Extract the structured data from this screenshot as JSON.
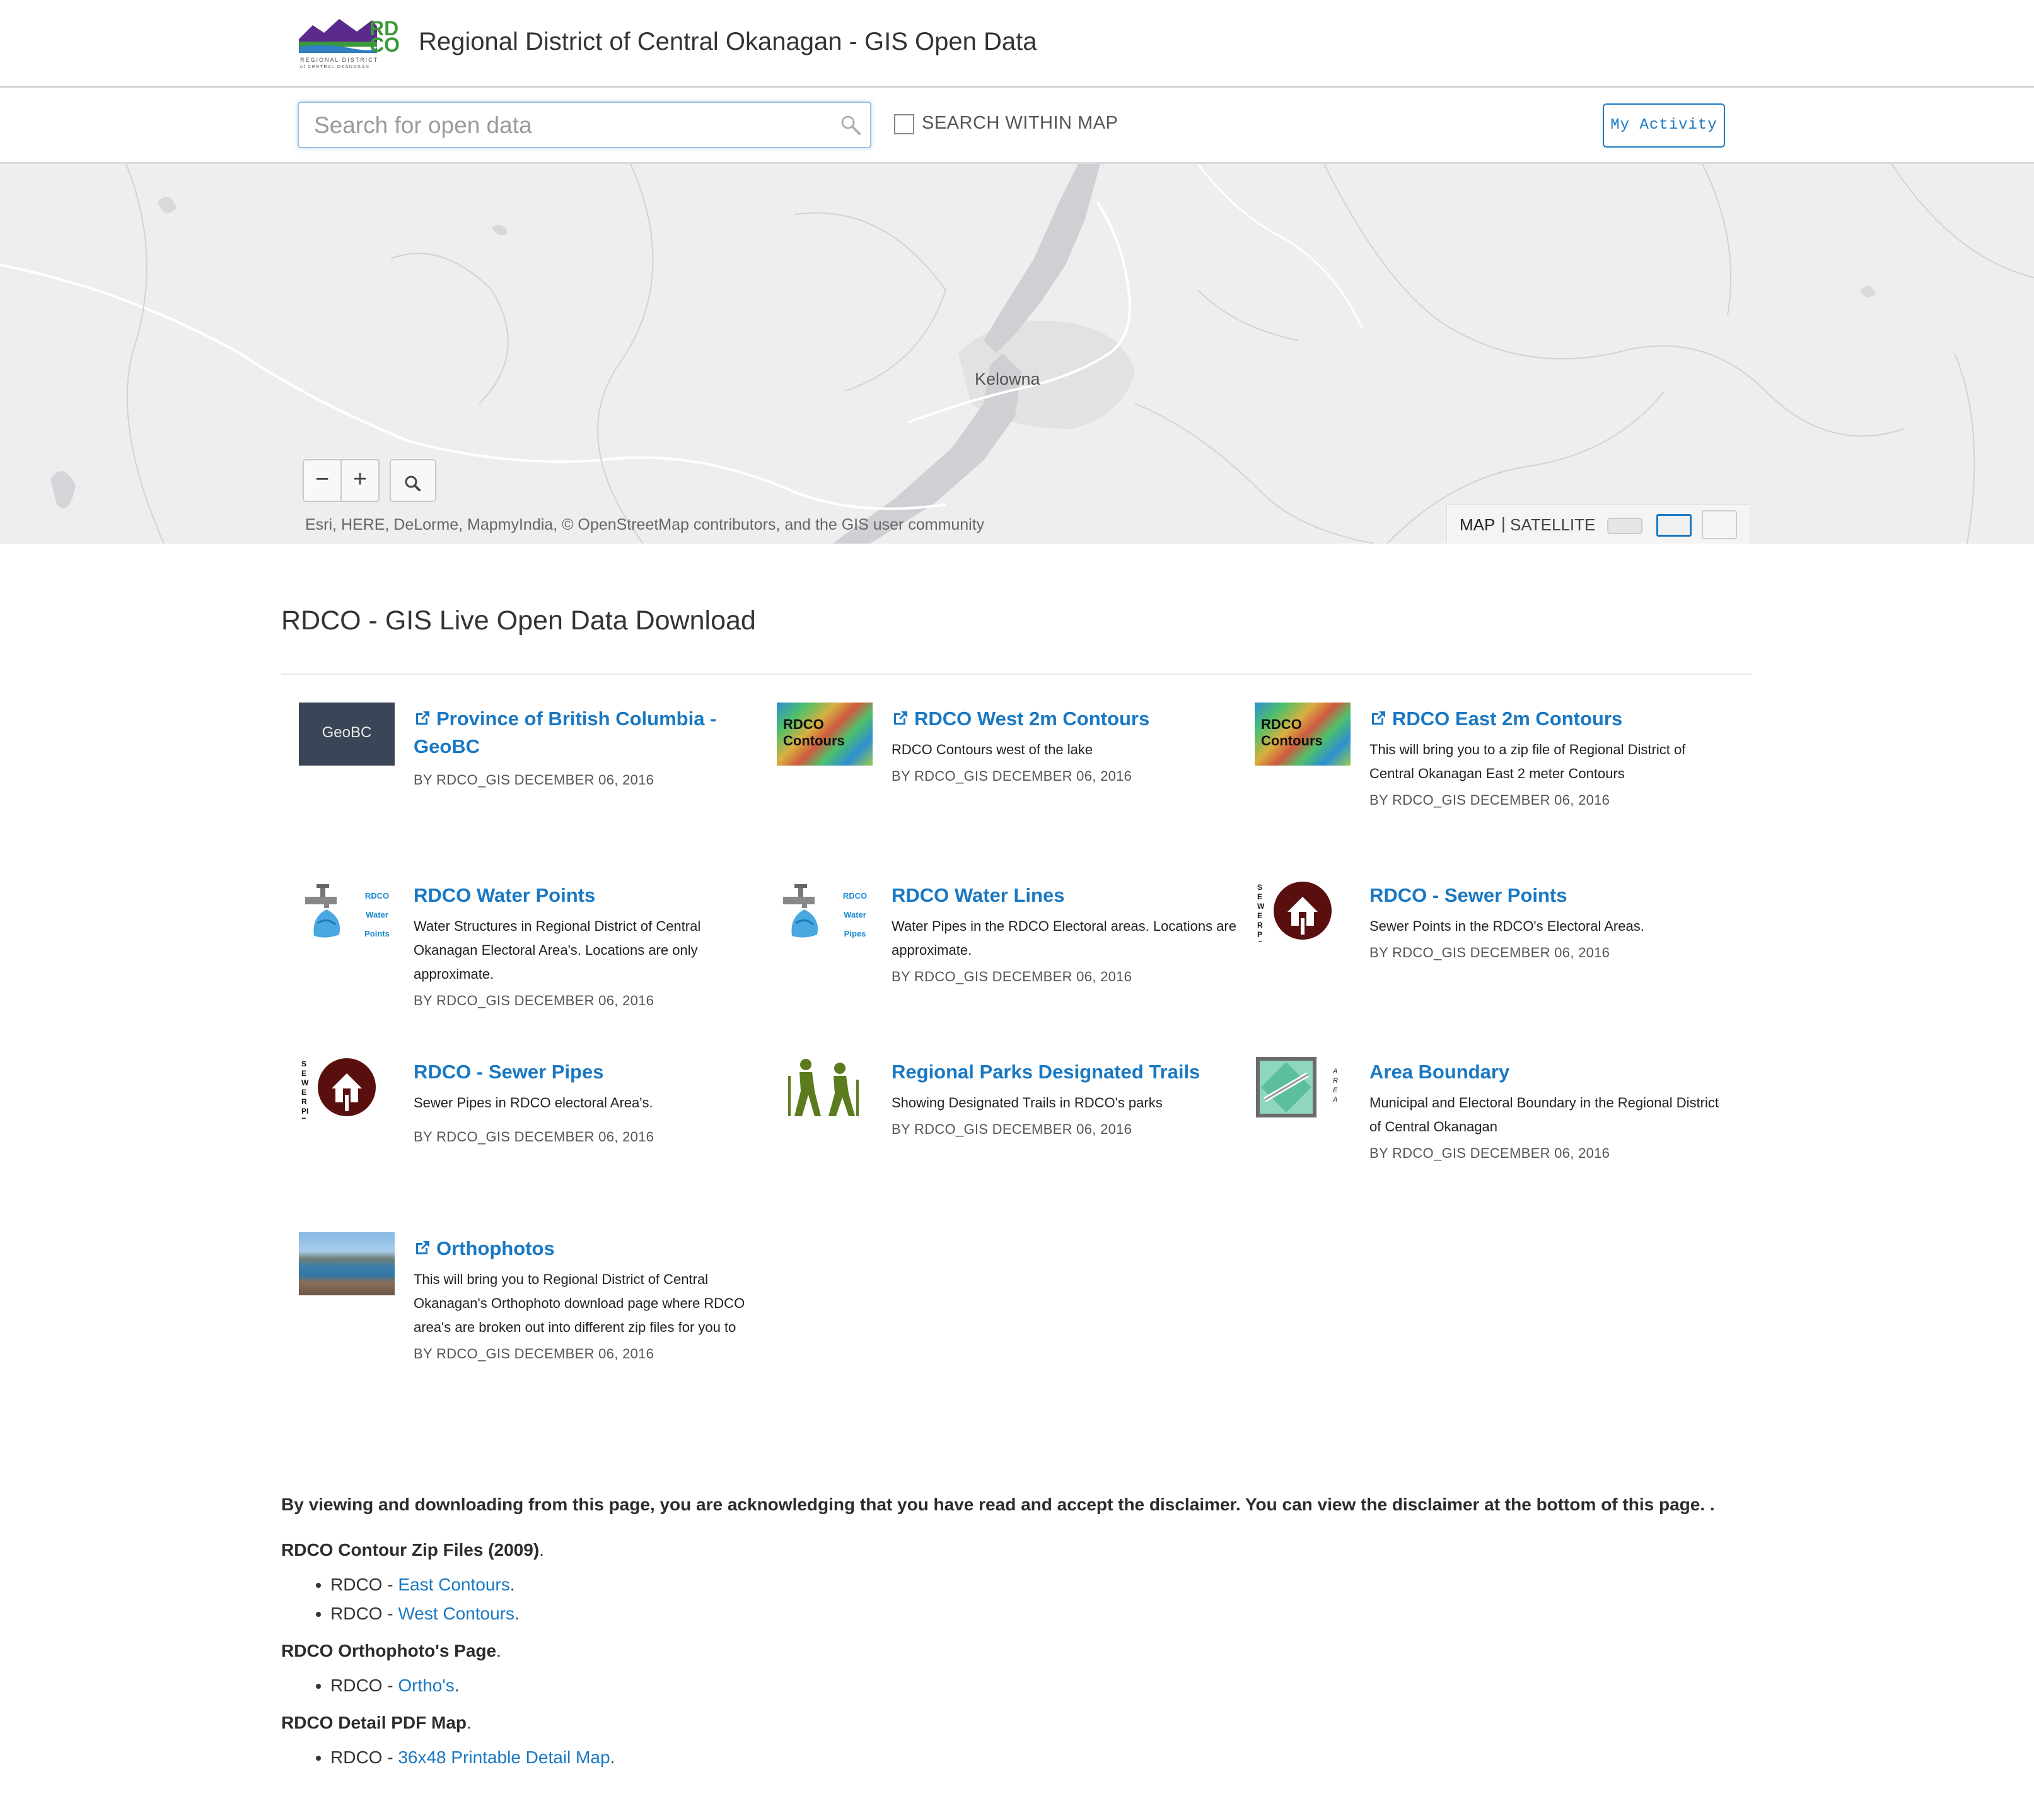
{
  "header": {
    "title": "Regional District of Central Okanagan - GIS Open Data",
    "logo_text": "RDCO",
    "logo_sub": "REGIONAL DISTRICT of CENTRAL OKANAGAN"
  },
  "search": {
    "placeholder": "Search for open data",
    "within_map_label": "SEARCH WITHIN MAP",
    "my_activity_label": "My Activity"
  },
  "map": {
    "city_label": "Kelowna",
    "zoom_out": "−",
    "zoom_in": "+",
    "attribution": "Esri, HERE, DeLorme, MapmyIndia, © OpenStreetMap contributors, and the GIS user community",
    "basemap_map": "MAP",
    "basemap_separator": "|",
    "basemap_satellite": "SATELLITE"
  },
  "section": {
    "title": "RDCO - GIS Live Open Data Download"
  },
  "datasets": [
    {
      "title": "Province of British Columbia - GeoBC",
      "description": "",
      "meta": "BY RDCO_GIS DECEMBER 06, 2016",
      "external": true,
      "thumb": "geobc",
      "thumb_text": "GeoBC"
    },
    {
      "title": "RDCO West 2m Contours",
      "description": "RDCO Contours west of the lake",
      "meta": "BY RDCO_GIS DECEMBER 06, 2016",
      "external": true,
      "thumb": "contours",
      "thumb_text": "RDCO Contours"
    },
    {
      "title": "RDCO East 2m Contours",
      "description": "This will bring you to a zip file of Regional District of Central Okanagan East 2 meter Contours",
      "meta": "BY RDCO_GIS DECEMBER 06, 2016",
      "external": true,
      "thumb": "contours",
      "thumb_text": "RDCO Contours"
    },
    {
      "title": "RDCO Water Points",
      "description": "Water Structures in Regional District of Central Okanagan Electoral Area's.  Locations are only approximate.",
      "meta": "BY RDCO_GIS DECEMBER 06, 2016",
      "external": false,
      "thumb": "water",
      "thumb_text": "RDCO Water Points"
    },
    {
      "title": "RDCO Water Lines",
      "description": "Water Pipes in the RDCO Electoral areas. Locations are approximate.",
      "meta": "BY RDCO_GIS DECEMBER 06, 2016",
      "external": false,
      "thumb": "water",
      "thumb_text": "RDCO Water Pipes"
    },
    {
      "title": "RDCO - Sewer Points",
      "description": "Sewer Points in the RDCO's Electoral Areas.",
      "meta": "BY RDCO_GIS DECEMBER 06, 2016",
      "external": false,
      "thumb": "sewer",
      "thumb_text": "SEWER POINTS"
    },
    {
      "title": "RDCO - Sewer Pipes",
      "description": "Sewer Pipes in RDCO electoral Area's.",
      "meta": "BY RDCO_GIS DECEMBER 06, 2016",
      "external": false,
      "thumb": "sewer",
      "thumb_text": "SEWER PIPES"
    },
    {
      "title": "Regional Parks Designated Trails",
      "description": "Showing Designated Trails in RDCO's parks",
      "meta": "BY RDCO_GIS DECEMBER 06, 2016",
      "external": false,
      "thumb": "trails",
      "thumb_text": ""
    },
    {
      "title": "Area Boundary",
      "description": "Municipal and Electoral Boundary in the Regional District of Central Okanagan",
      "meta": "BY RDCO_GIS DECEMBER 06, 2016",
      "external": false,
      "thumb": "area",
      "thumb_text": "AREA"
    },
    {
      "title": "Orthophotos",
      "description": "This will bring you to Regional District of Central Okanagan's Orthophoto download page where RDCO area's are broken out into different zip files for you to",
      "meta": "BY RDCO_GIS DECEMBER 06, 2016",
      "external": true,
      "thumb": "ortho",
      "thumb_text": ""
    }
  ],
  "notes": {
    "disclaimer": "By viewing and downloading from this page, you are acknowledging that you have read and accept the disclaimer. You can view the disclaimer at the bottom of this page. .",
    "groups": [
      {
        "heading": "RDCO Contour Zip Files (2009)",
        "items": [
          {
            "prefix": "RDCO - ",
            "link": "East Contours"
          },
          {
            "prefix": "RDCO - ",
            "link": "West Contours"
          }
        ]
      },
      {
        "heading": "RDCO Orthophoto's Page",
        "items": [
          {
            "prefix": "RDCO - ",
            "link": "Ortho's"
          }
        ]
      },
      {
        "heading": "RDCO Detail PDF Map",
        "items": [
          {
            "prefix": "RDCO - ",
            "link": "36x48 Printable Detail Map"
          }
        ]
      }
    ]
  },
  "colors": {
    "link": "#1a78c2",
    "header_border": "#cfd3d6",
    "map_bg": "#eeeeee",
    "lake": "#cfd0d4"
  }
}
